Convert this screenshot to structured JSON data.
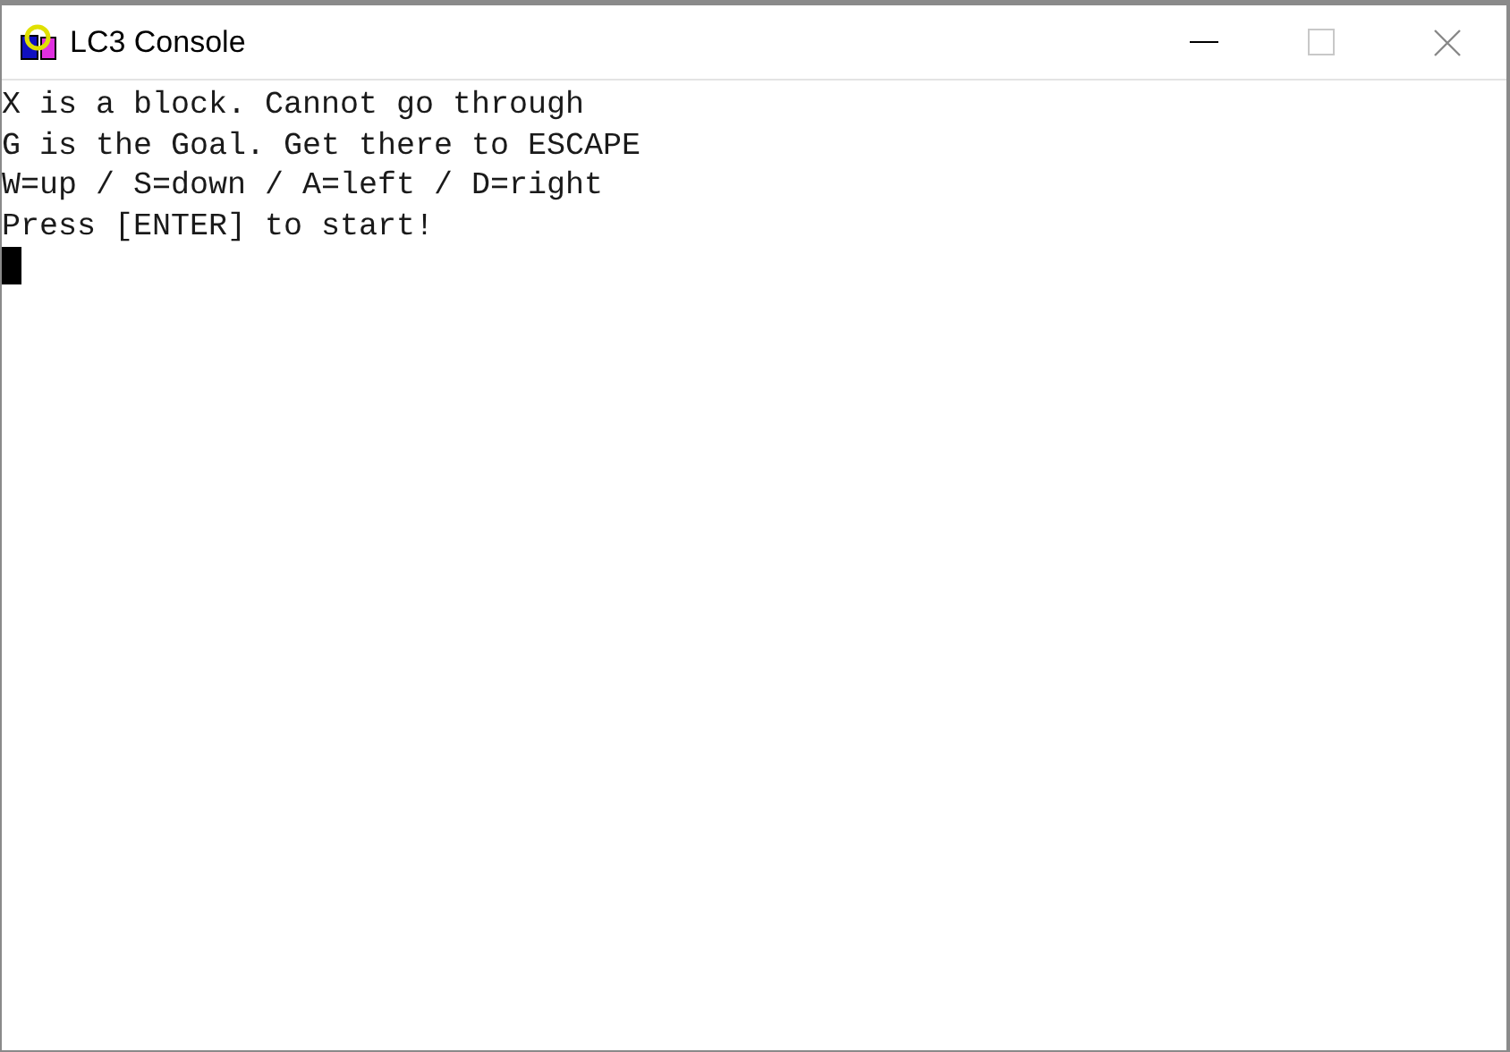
{
  "window": {
    "title": "LC3 Console",
    "maximize_enabled": false
  },
  "console": {
    "lines": [
      "X is a block. Cannot go through",
      "G is the Goal. Get there to ESCAPE",
      "W=up / S=down / A=left / D=right",
      "Press [ENTER] to start!"
    ],
    "cursor_visible": true
  }
}
